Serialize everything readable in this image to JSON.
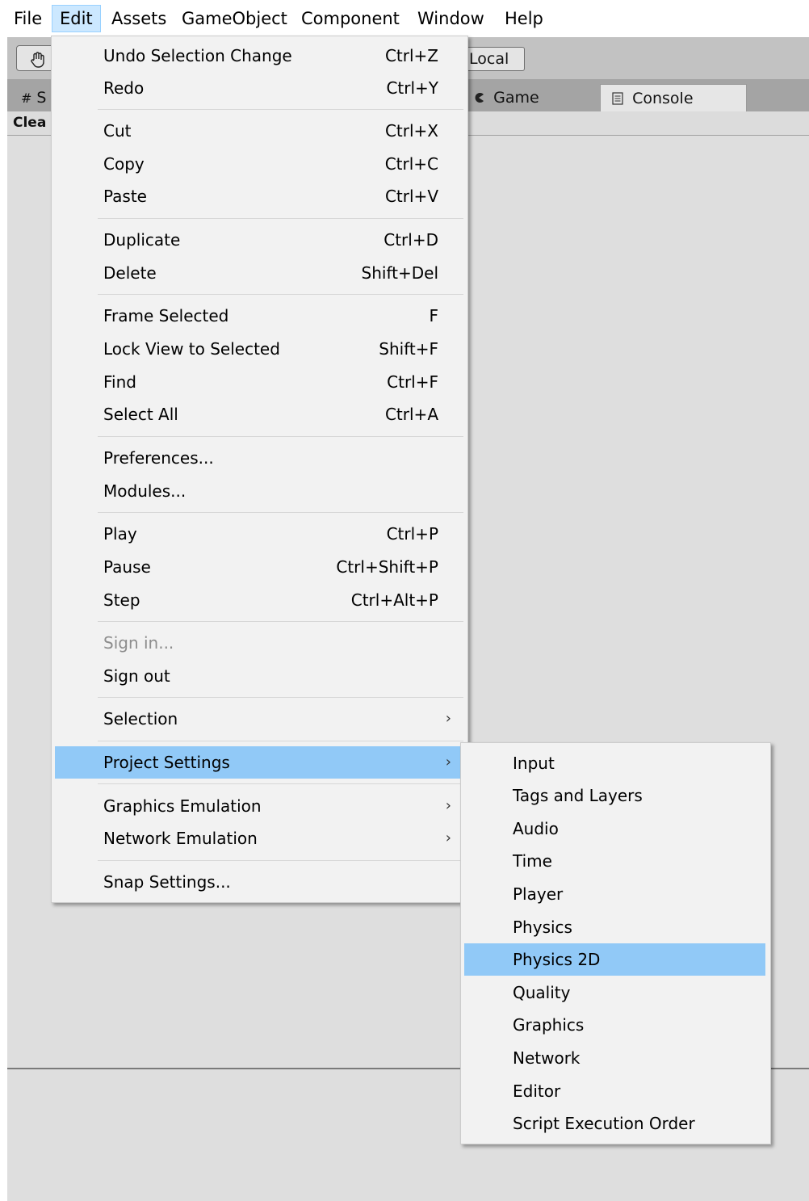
{
  "menubar": {
    "items": [
      "File",
      "Edit",
      "Assets",
      "GameObject",
      "Component",
      "Window",
      "Help"
    ],
    "active": "Edit"
  },
  "toolbar": {
    "local_label": "Local"
  },
  "tabs": {
    "scene": "S",
    "game": "Game",
    "console": "Console"
  },
  "console": {
    "clear_label": "Clea"
  },
  "edit_menu": {
    "undo": {
      "label": "Undo Selection Change",
      "shortcut": "Ctrl+Z"
    },
    "redo": {
      "label": "Redo",
      "shortcut": "Ctrl+Y"
    },
    "cut": {
      "label": "Cut",
      "shortcut": "Ctrl+X"
    },
    "copy": {
      "label": "Copy",
      "shortcut": "Ctrl+C"
    },
    "paste": {
      "label": "Paste",
      "shortcut": "Ctrl+V"
    },
    "duplicate": {
      "label": "Duplicate",
      "shortcut": "Ctrl+D"
    },
    "delete": {
      "label": "Delete",
      "shortcut": "Shift+Del"
    },
    "frame_selected": {
      "label": "Frame Selected",
      "shortcut": "F"
    },
    "lock_view": {
      "label": "Lock View to Selected",
      "shortcut": "Shift+F"
    },
    "find": {
      "label": "Find",
      "shortcut": "Ctrl+F"
    },
    "select_all": {
      "label": "Select All",
      "shortcut": "Ctrl+A"
    },
    "preferences": {
      "label": "Preferences..."
    },
    "modules": {
      "label": "Modules..."
    },
    "play": {
      "label": "Play",
      "shortcut": "Ctrl+P"
    },
    "pause": {
      "label": "Pause",
      "shortcut": "Ctrl+Shift+P"
    },
    "step": {
      "label": "Step",
      "shortcut": "Ctrl+Alt+P"
    },
    "sign_in": {
      "label": "Sign in..."
    },
    "sign_out": {
      "label": "Sign out"
    },
    "selection": {
      "label": "Selection"
    },
    "project_settings": {
      "label": "Project Settings"
    },
    "graphics_emulation": {
      "label": "Graphics Emulation"
    },
    "network_emulation": {
      "label": "Network Emulation"
    },
    "snap_settings": {
      "label": "Snap Settings..."
    }
  },
  "project_settings_submenu": {
    "items": [
      "Input",
      "Tags and Layers",
      "Audio",
      "Time",
      "Player",
      "Physics",
      "Physics 2D",
      "Quality",
      "Graphics",
      "Network",
      "Editor",
      "Script Execution Order"
    ],
    "highlighted": "Physics 2D"
  },
  "icons": {
    "hand_tool": "hand-icon",
    "scene_tab": "hash-icon",
    "game_tab": "pacman-icon",
    "console_tab": "console-doc-icon",
    "submenu_arrow": "chevron-right-icon"
  },
  "colors": {
    "highlight": "#91c9f7",
    "menu_bg": "#f2f2f2",
    "editor_bg": "#c2c2c2",
    "disabled_text": "#8d8d8d"
  }
}
